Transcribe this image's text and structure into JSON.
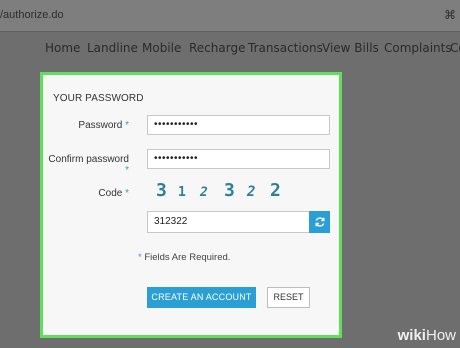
{
  "browser": {
    "url": "/authorize.do"
  },
  "nav": {
    "items": [
      "Home",
      "Landline",
      "Mobile",
      "Recharge",
      "Transactions",
      "View Bills",
      "Complaints",
      "Co"
    ]
  },
  "form": {
    "title": "YOUR PASSWORD",
    "required_mark": "*",
    "password_label": "Password",
    "password_value": "•••••••••••",
    "confirm_label": "Confirm password",
    "confirm_value": "•••••••••••",
    "code_label": "Code",
    "captcha_chars": [
      "3",
      "1",
      "2",
      "3",
      "2",
      "2"
    ],
    "code_value": "312322",
    "required_note": "Fields Are Required.",
    "create_button": "CREATE AN ACCOUNT",
    "reset_button": "RESET"
  },
  "watermark": {
    "wiki": "wiki",
    "how": "How"
  },
  "colors": {
    "accent": "#2a9fd6",
    "highlight_border": "#5ee05a",
    "captcha": "#2f7f9a"
  },
  "icons": {
    "refresh": "refresh-icon",
    "key": "key-icon"
  }
}
